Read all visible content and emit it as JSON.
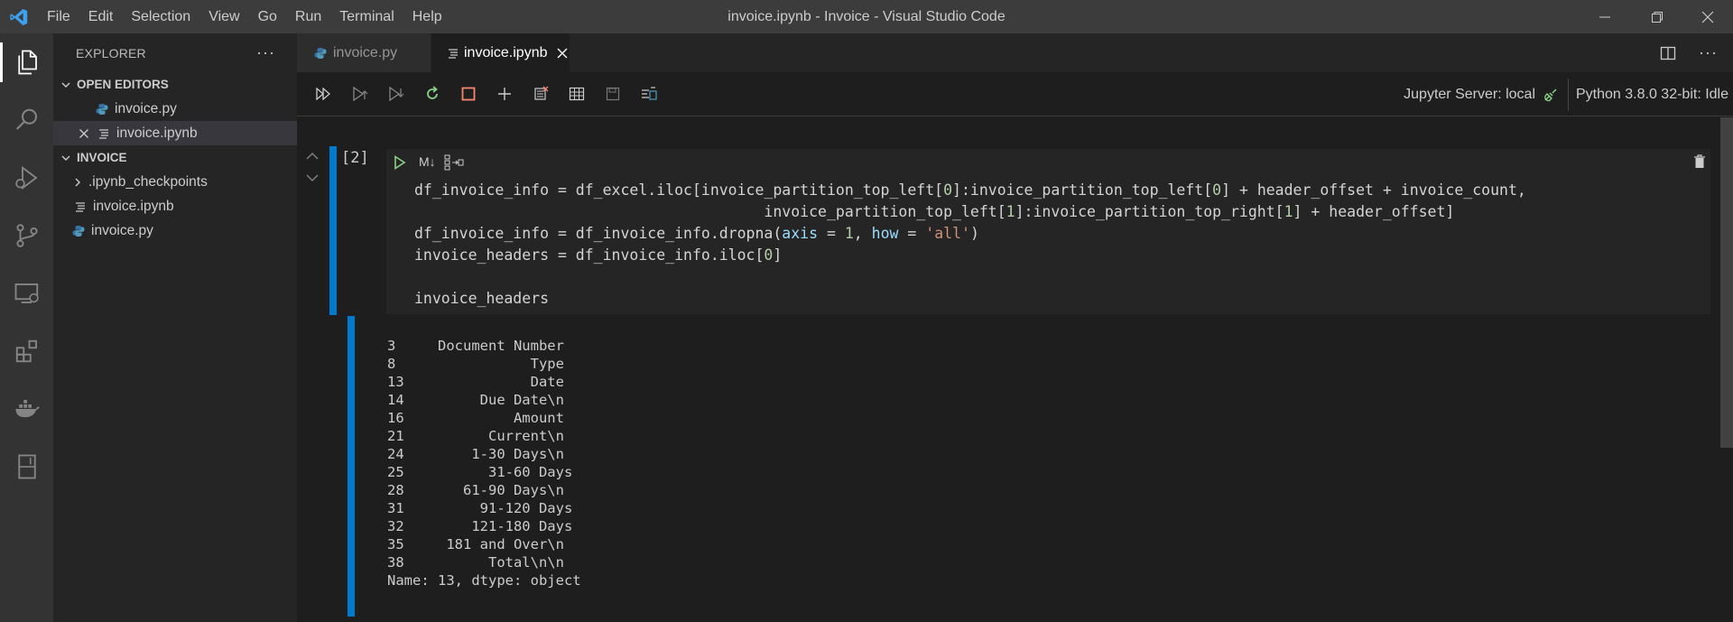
{
  "window": {
    "title": "invoice.ipynb - Invoice - Visual Studio Code",
    "menu": [
      "File",
      "Edit",
      "Selection",
      "View",
      "Go",
      "Run",
      "Terminal",
      "Help"
    ]
  },
  "sidebar": {
    "header": "EXPLORER",
    "open_editors_label": "OPEN EDITORS",
    "open_editors": [
      {
        "label": "invoice.py",
        "type": "python"
      },
      {
        "label": "invoice.ipynb",
        "type": "notebook"
      }
    ],
    "folder_label": "INVOICE",
    "files": [
      {
        "label": ".ipynb_checkpoints",
        "type": "folder"
      },
      {
        "label": "invoice.ipynb",
        "type": "notebook"
      },
      {
        "label": "invoice.py",
        "type": "python"
      }
    ]
  },
  "tabs": [
    {
      "label": "invoice.py",
      "active": false
    },
    {
      "label": "invoice.ipynb",
      "active": true
    }
  ],
  "toolbar": {
    "jupyter_server": "Jupyter Server: local",
    "kernel": "Python 3.8.0 32-bit: Idle"
  },
  "cell": {
    "exec_count": "[2]",
    "markdown_label": "M↓"
  },
  "code": {
    "l1": [
      {
        "t": "df_invoice_info = df_excel.iloc[invoice_partition_top_left["
      },
      {
        "t": "0",
        "c": "num"
      },
      {
        "t": "]:invoice_partition_top_left["
      },
      {
        "t": "0",
        "c": "num"
      },
      {
        "t": "] + header_offset + invoice_count,"
      }
    ],
    "l2": [
      {
        "t": "                                       invoice_partition_top_left["
      },
      {
        "t": "1",
        "c": "num"
      },
      {
        "t": "]:invoice_partition_top_right["
      },
      {
        "t": "1",
        "c": "num"
      },
      {
        "t": "] + header_offset]"
      }
    ],
    "l3": [
      {
        "t": "df_invoice_info = df_invoice_info.dropna("
      },
      {
        "t": "axis",
        "c": "kw"
      },
      {
        "t": " = "
      },
      {
        "t": "1",
        "c": "num"
      },
      {
        "t": ", "
      },
      {
        "t": "how",
        "c": "kw"
      },
      {
        "t": " = "
      },
      {
        "t": "'all'",
        "c": "str"
      },
      {
        "t": ")"
      }
    ],
    "l4": [
      {
        "t": "invoice_headers = df_invoice_info.iloc["
      },
      {
        "t": "0",
        "c": "num"
      },
      {
        "t": "]"
      }
    ],
    "l5": [
      {
        "t": "invoice_headers"
      }
    ]
  },
  "output": [
    "3     Document Number",
    "8                Type",
    "13               Date",
    "14         Due Date\\n",
    "16             Amount",
    "21          Current\\n",
    "24        1-30 Days\\n",
    "25          31-60 Days",
    "28       61-90 Days\\n",
    "31         91-120 Days",
    "32        121-180 Days",
    "35     181 and Over\\n",
    "38          Total\\n\\n",
    "Name: 13, dtype: object"
  ]
}
